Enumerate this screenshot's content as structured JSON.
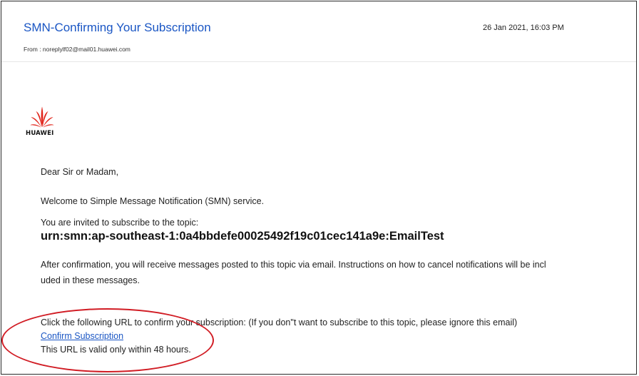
{
  "email": {
    "subject": "SMN-Confirming Your Subscription",
    "date": "26 Jan 2021, 16:03 PM",
    "from": "From : noreplylf02@mail01.huawei.com"
  },
  "logo": {
    "text": "HUAWEI",
    "color": "#e1251b"
  },
  "body": {
    "greeting": "Dear Sir or Madam,",
    "welcome": "Welcome to Simple Message Notification (SMN) service.",
    "invite": "You are invited to subscribe to the topic:",
    "topic": "urn:smn:ap-southeast-1:0a4bbdefe00025492f19c01cec141a9e:EmailTest",
    "after_line1": "After confirmation, you will receive messages posted to this topic via email. Instructions on how to cancel notifications will be incl",
    "after_line2": "uded in these messages.",
    "click_text": "Click the following URL to confirm your subscription: (If you don\"t want to subscribe to this topic, please ignore this email)",
    "confirm_link": "Confirm Subscription",
    "valid_text": "This URL is valid only within 48 hours."
  },
  "colors": {
    "link": "#1a56c4",
    "annotation": "#d11c24"
  }
}
